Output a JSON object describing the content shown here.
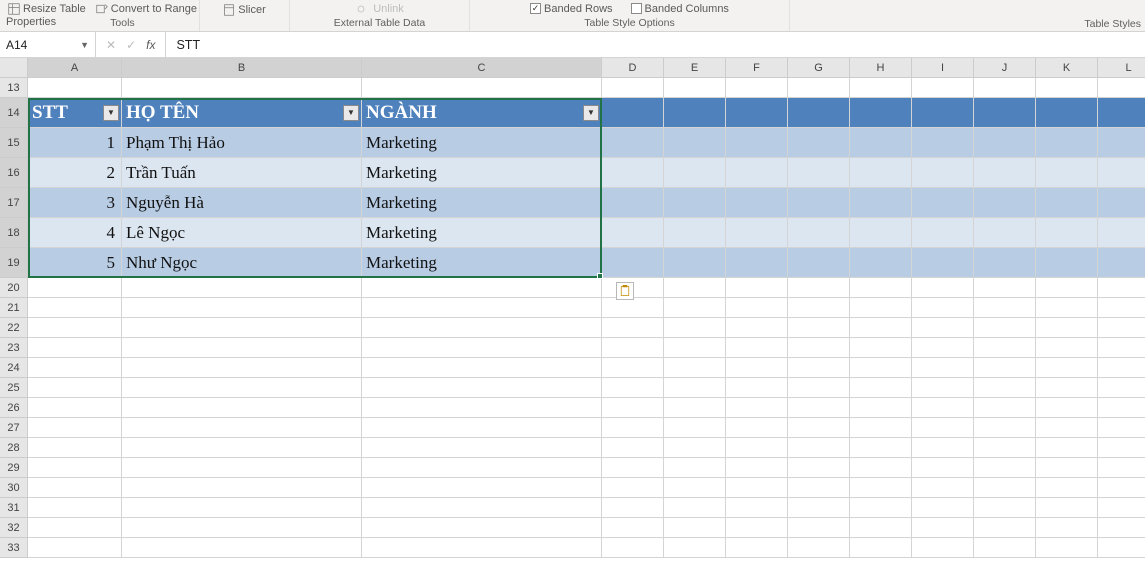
{
  "ribbon": {
    "resize_table": "Resize Table",
    "convert_range": "Convert to Range",
    "tools_label": "Tools",
    "slicer": "Slicer",
    "ext_table_data": "External Table Data",
    "properties": "Properties",
    "unlink": "Unlink",
    "banded_rows": "Banded Rows",
    "banded_cols": "Banded Columns",
    "style_options": "Table Style Options",
    "table_styles": "Table Styles"
  },
  "namebox": "A14",
  "formula_value": "STT",
  "colheads": [
    "A",
    "B",
    "C",
    "D",
    "E",
    "F",
    "G",
    "H",
    "I",
    "J",
    "K",
    "L"
  ],
  "first_row": 13,
  "row_count": 21,
  "table": {
    "headers": {
      "stt": "STT",
      "name": "HỌ TÊN",
      "major": "NGÀNH"
    },
    "rows": [
      {
        "stt": "1",
        "name": "Phạm Thị Hảo",
        "major": "Marketing"
      },
      {
        "stt": "2",
        "name": "Trần Tuấn",
        "major": "Marketing"
      },
      {
        "stt": "3",
        "name": "Nguyễn Hà",
        "major": "Marketing"
      },
      {
        "stt": "4",
        "name": "Lê Ngọc",
        "major": "Marketing"
      },
      {
        "stt": "5",
        "name": "Như Ngọc",
        "major": "Marketing"
      }
    ]
  }
}
